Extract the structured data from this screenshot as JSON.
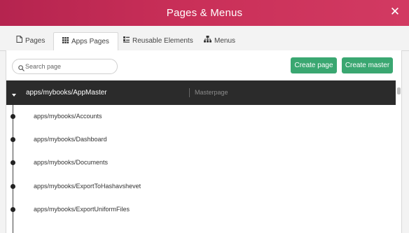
{
  "dialog": {
    "title": "Pages & Menus",
    "close_glyph": "✕"
  },
  "tabs": [
    {
      "label": "Pages",
      "icon": "page-icon",
      "active": false
    },
    {
      "label": "Apps Pages",
      "icon": "grid-icon",
      "active": true
    },
    {
      "label": "Reusable Elements",
      "icon": "elements-icon",
      "active": false
    },
    {
      "label": "Menus",
      "icon": "sitemap-icon",
      "active": false
    }
  ],
  "search": {
    "placeholder": "Search page",
    "value": ""
  },
  "buttons": {
    "create_page": "Create page",
    "create_master": "Create master"
  },
  "master": {
    "name": "apps/mybooks/AppMaster",
    "type": "Masterpage",
    "expanded": true
  },
  "pages": [
    "apps/mybooks/Accounts",
    "apps/mybooks/Dashboard",
    "apps/mybooks/Documents",
    "apps/mybooks/ExportToHashavshevet",
    "apps/mybooks/ExportUniformFiles"
  ],
  "colors": {
    "title_gradient_start": "#b5244f",
    "title_gradient_end": "#d23a62",
    "accent_green": "#3aa771",
    "master_row_bg": "#2b2b2b"
  }
}
